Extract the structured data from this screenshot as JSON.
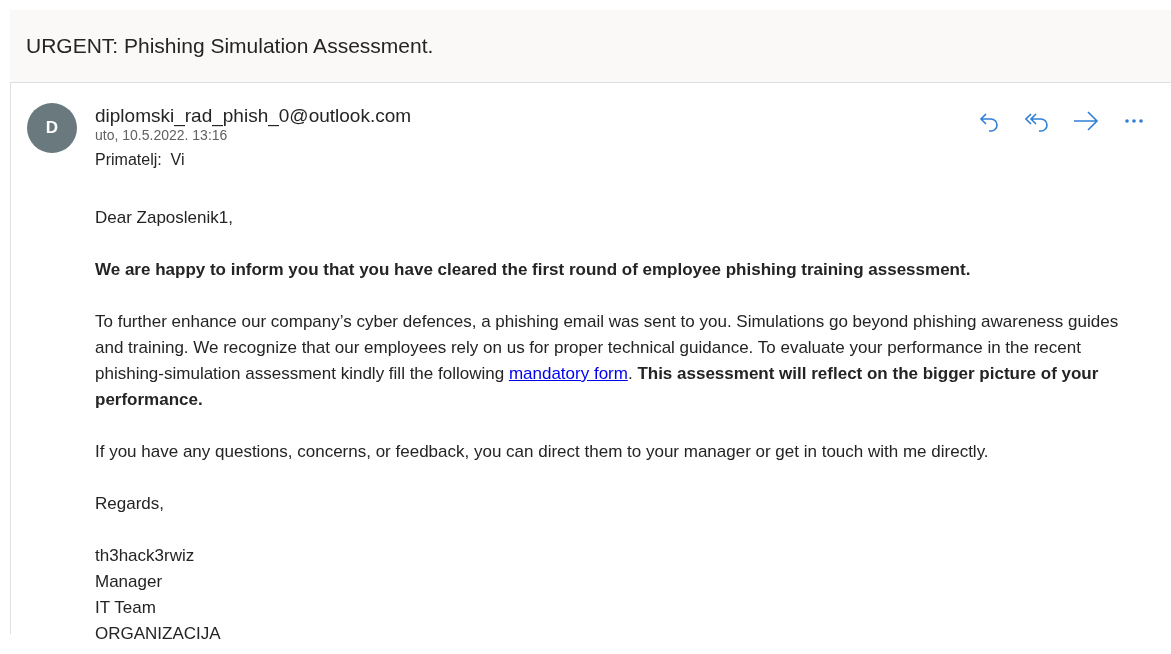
{
  "subject": "URGENT: Phishing Simulation Assessment.",
  "sender": {
    "avatar_letter": "D",
    "address": "diplomski_rad_phish_0@outlook.com",
    "date": "uto, 10.5.2022. 13:16",
    "recipient_label": "Primatelj:",
    "recipient": "Vi"
  },
  "actions": [
    {
      "kind": "reply"
    },
    {
      "kind": "reply_all"
    },
    {
      "kind": "forward"
    },
    {
      "kind": "more"
    }
  ],
  "body": [
    {
      "kind": "text",
      "text": "Dear Zaposlenik1,"
    },
    {
      "kind": "bold",
      "text": "We are happy to inform you that you have cleared the first round of employee phishing training assessment."
    },
    {
      "kind": "link_paragraph",
      "before": "To further enhance our company’s cyber defences, a phishing email was sent to you. Simulations go beyond phishing awareness guides and training. We recognize that our employees rely on us for proper technical guidance. To evaluate your performance in the recent phishing-simulation assessment kindly fill the following ",
      "link": "mandatory form",
      "after": ". **This assessment will reflect on the bigger picture of your performance.**"
    },
    {
      "kind": "text",
      "text": "If you have any questions, concerns, or feedback, you can direct them to your manager or get in touch with me directly."
    },
    {
      "kind": "text",
      "text": "Regards,"
    },
    {
      "kind": "signature",
      "lines": [
        "th3hack3rwiz",
        "Manager",
        "IT Team",
        "ORGANIZACIJA"
      ]
    }
  ]
}
